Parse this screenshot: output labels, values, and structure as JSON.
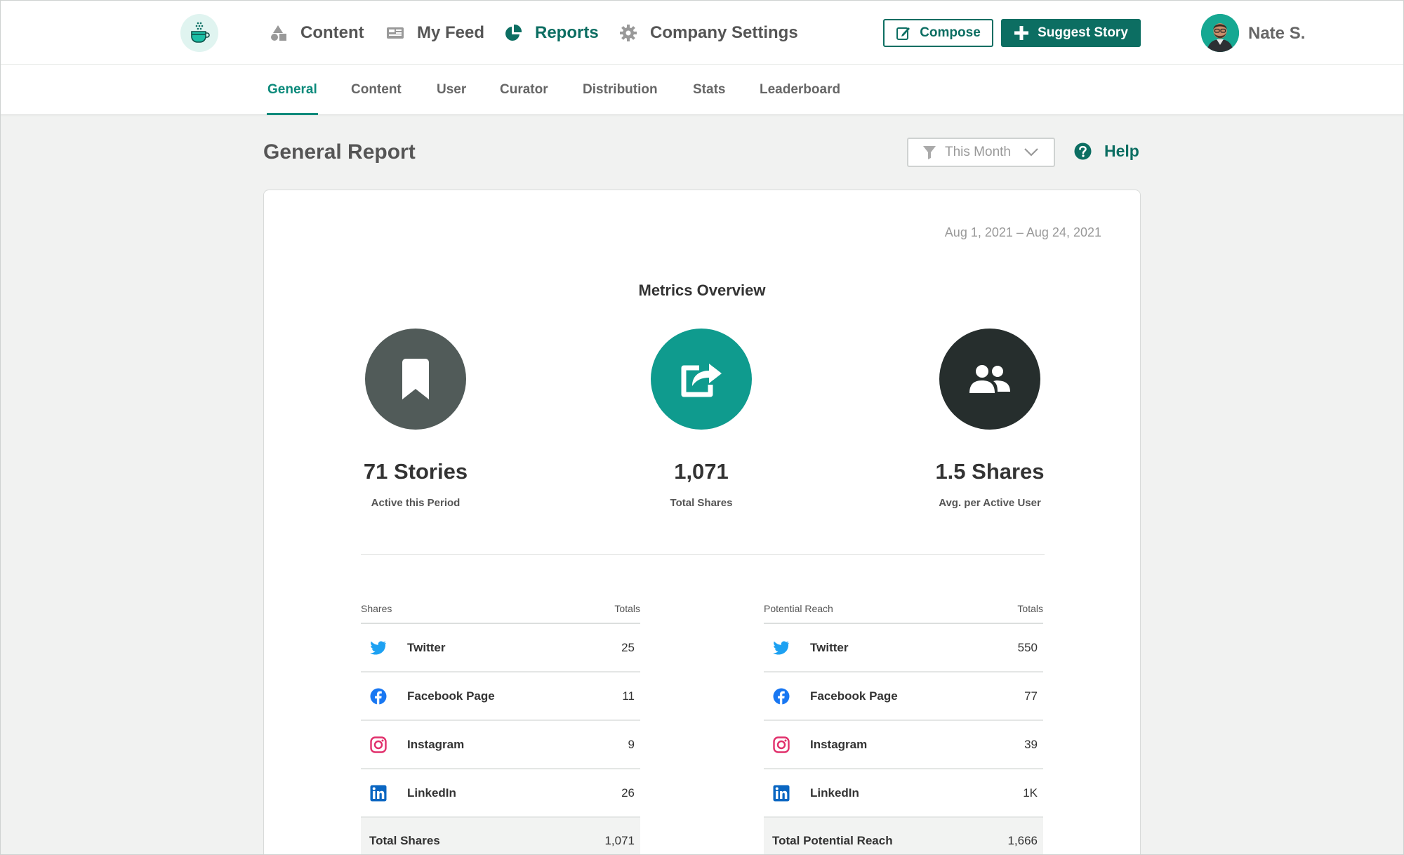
{
  "nav": {
    "items": [
      {
        "label": "Content",
        "icon": "shapes-icon"
      },
      {
        "label": "My Feed",
        "icon": "feed-icon"
      },
      {
        "label": "Reports",
        "icon": "pie-chart-icon"
      },
      {
        "label": "Company Settings",
        "icon": "gear-icon"
      }
    ],
    "active": "Reports",
    "compose_label": "Compose",
    "suggest_label": "Suggest Story",
    "user_name": "Nate S."
  },
  "subnav": {
    "tabs": [
      "General",
      "Content",
      "User",
      "Curator",
      "Distribution",
      "Stats",
      "Leaderboard"
    ],
    "active": "General"
  },
  "page": {
    "title": "General Report",
    "filter_label": "This Month",
    "help_label": "Help"
  },
  "report": {
    "date_range": "Aug 1, 2021 – Aug 24, 2021",
    "metrics_title": "Metrics Overview",
    "metrics": [
      {
        "value": "71 Stories",
        "caption": "Active this Period",
        "icon": "bookmark-icon",
        "color": "#515b59"
      },
      {
        "value": "1,071",
        "caption": "Total Shares",
        "icon": "share-icon",
        "color": "#0f9b8e"
      },
      {
        "value": "1.5 Shares",
        "caption": "Avg. per Active User",
        "icon": "users-icon",
        "color": "#262e2d"
      }
    ]
  },
  "shares_table": {
    "header_left": "Shares",
    "header_right": "Totals",
    "rows": [
      {
        "name": "Twitter",
        "value": "25",
        "icon": "twitter-icon"
      },
      {
        "name": "Facebook Page",
        "value": "11",
        "icon": "facebook-icon"
      },
      {
        "name": "Instagram",
        "value": "9",
        "icon": "instagram-icon"
      },
      {
        "name": "LinkedIn",
        "value": "26",
        "icon": "linkedin-icon"
      }
    ],
    "total_label": "Total Shares",
    "total_value": "1,071"
  },
  "reach_table": {
    "header_left": "Potential Reach",
    "header_right": "Totals",
    "rows": [
      {
        "name": "Twitter",
        "value": "550",
        "icon": "twitter-icon"
      },
      {
        "name": "Facebook Page",
        "value": "77",
        "icon": "facebook-icon"
      },
      {
        "name": "Instagram",
        "value": "39",
        "icon": "instagram-icon"
      },
      {
        "name": "LinkedIn",
        "value": "1K",
        "icon": "linkedin-icon"
      }
    ],
    "total_label": "Total Potential Reach",
    "total_value": "1,666"
  },
  "colors": {
    "brand": "#0c6e62",
    "accent": "#0c8a7b",
    "twitter": "#1da1f2",
    "facebook": "#1877f2",
    "instagram": "#e1306c",
    "linkedin": "#0a66c2"
  }
}
